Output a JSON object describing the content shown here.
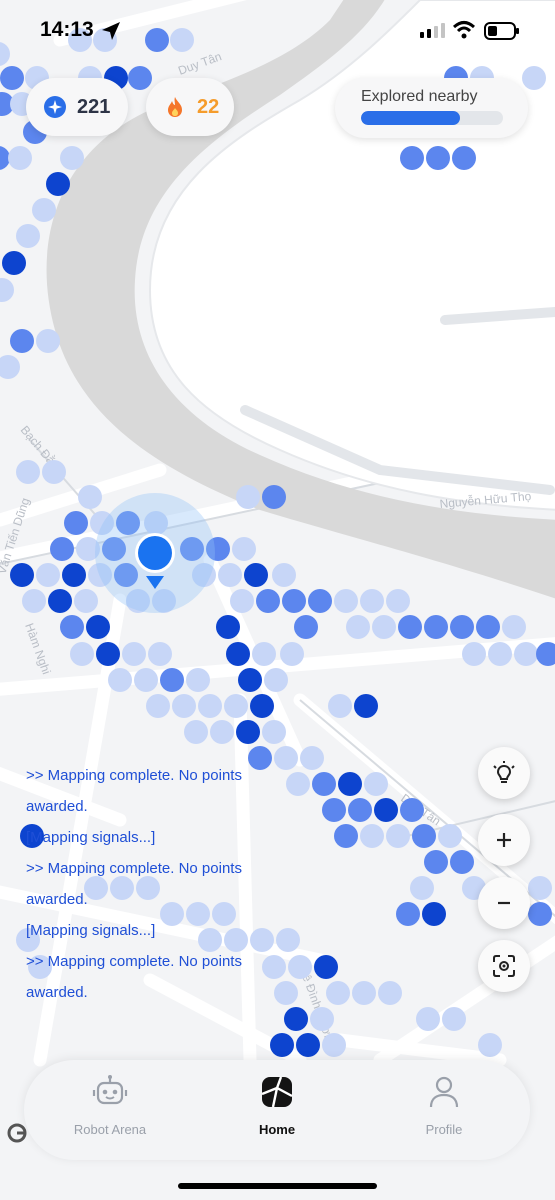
{
  "status_bar": {
    "time": "14:13"
  },
  "stats": {
    "points": "221",
    "streak": "22"
  },
  "explored": {
    "label": "Explored nearby",
    "progress": 0.7
  },
  "log": [
    ">> Mapping complete. No points awarded.",
    "[Mapping signals...]",
    ">> Mapping complete. No points awarded.",
    "[Mapping signals...]",
    ">> Mapping complete. No points awarded."
  ],
  "map": {
    "street_labels": [
      "Duy Tân",
      "Bạch Đằng",
      "Nguyễn Hữu Thọ",
      "Văn Tiến Dũng",
      "Hàm Nghi",
      "Duy Tân",
      "Lê Đình Dương"
    ]
  },
  "tabs": [
    {
      "label": "Robot Arena",
      "active": false
    },
    {
      "label": "Home",
      "active": true
    },
    {
      "label": "Profile",
      "active": false
    }
  ],
  "colors": {
    "accent": "#2a6ee8",
    "streak": "#f59c2c",
    "log_text": "#1f4fd6",
    "river": "#d9d9d9",
    "road": "#ffffff",
    "dot_light": "#c7d6f7",
    "dot_mid": "#5c86ee",
    "dot_dark": "#0d44cf"
  },
  "icons": {
    "location": "location-arrow-icon",
    "points": "compass-star-icon",
    "streak": "flame-icon",
    "hint": "lightbulb-icon",
    "zoom_in": "plus-icon",
    "zoom_out": "minus-icon",
    "recenter": "recenter-icon",
    "robot": "robot-icon",
    "home": "map-tile-icon",
    "profile": "person-icon"
  }
}
